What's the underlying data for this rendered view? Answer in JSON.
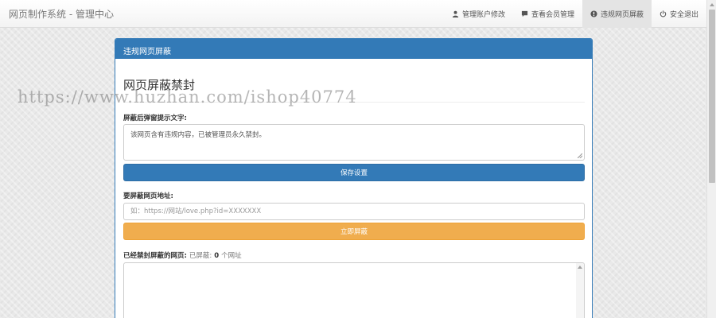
{
  "navbar": {
    "brand": "网页制作系统 - 管理中心",
    "items": [
      {
        "label": "管理账户修改",
        "icon": "user-icon"
      },
      {
        "label": "查看会员管理",
        "icon": "comment-icon"
      },
      {
        "label": "违规网页屏蔽",
        "icon": "exclamation-icon",
        "active": true
      },
      {
        "label": "安全退出",
        "icon": "power-icon"
      }
    ]
  },
  "panel": {
    "title": "违规网页屏蔽",
    "heading": "网页屏蔽禁封",
    "notice_label": "屏蔽后弹窗提示文字:",
    "notice_value": "该网页含有违规内容，已被管理员永久禁封。",
    "save_label": "保存设置",
    "url_label": "要屏蔽网页地址:",
    "url_placeholder": "如：https://网站/love.php?id=XXXXXXX",
    "block_label": "立即屏蔽",
    "list_label": "已经禁封屏蔽的网页:",
    "list_count_prefix": "已屏蔽:",
    "list_count_value": "0",
    "list_count_suffix": "个网址",
    "list_value": ""
  },
  "watermark": "https://www.huzhan.com/ishop40774",
  "colors": {
    "primary": "#337ab7",
    "warning": "#f0ad4e"
  }
}
